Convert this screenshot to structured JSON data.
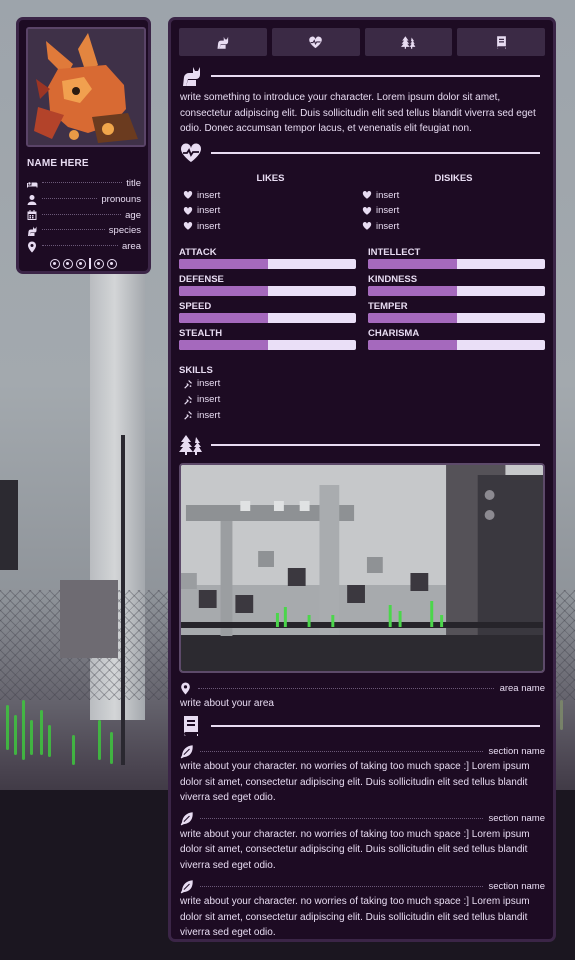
{
  "profile": {
    "name": "NAME HERE",
    "fields": [
      {
        "icon": "bed-icon",
        "value": "title"
      },
      {
        "icon": "person-icon",
        "value": "pronouns"
      },
      {
        "icon": "calendar-icon",
        "value": "age"
      },
      {
        "icon": "cat-icon",
        "value": "species"
      },
      {
        "icon": "map-pin-icon",
        "value": "area"
      }
    ]
  },
  "tabs": [
    {
      "icon": "cat-icon"
    },
    {
      "icon": "heart-pulse-icon"
    },
    {
      "icon": "trees-icon"
    },
    {
      "icon": "book-icon"
    }
  ],
  "intro": {
    "text": "write something to introduce your character. Lorem ipsum dolor sit amet, consectetur adipiscing elit. Duis sollicitudin elit sed tellus blandit viverra sed eget odio. Donec accumsan tempor lacus, et venenatis elit feugiat non."
  },
  "likes": {
    "title": "LIKES",
    "items": [
      "insert",
      "insert",
      "insert"
    ]
  },
  "dislikes": {
    "title": "DISIKES",
    "items": [
      "insert",
      "insert",
      "insert"
    ]
  },
  "stats": [
    {
      "label": "ATTACK",
      "value": 0.5
    },
    {
      "label": "INTELLECT",
      "value": 0.5
    },
    {
      "label": "DEFENSE",
      "value": 0.5
    },
    {
      "label": "KINDNESS",
      "value": 0.5
    },
    {
      "label": "SPEED",
      "value": 0.5
    },
    {
      "label": "TEMPER",
      "value": 0.5
    },
    {
      "label": "STEALTH",
      "value": 0.5
    },
    {
      "label": "CHARISMA",
      "value": 0.5
    }
  ],
  "skills": {
    "title": "SKILLS",
    "items": [
      "insert",
      "insert",
      "insert"
    ]
  },
  "area": {
    "name": "area name",
    "text": "write about your area"
  },
  "lore": [
    {
      "name": "section name",
      "text": "write about your character. no worries of taking too much space :] Lorem ipsum dolor sit amet, consectetur adipiscing elit. Duis sollicitudin elit sed tellus blandit viverra sed eget odio."
    },
    {
      "name": "section name",
      "text": "write about your character. no worries of taking too much space :] Lorem ipsum dolor sit amet, consectetur adipiscing elit. Duis sollicitudin elit sed tellus blandit viverra sed eget odio."
    },
    {
      "name": "section name",
      "text": "write about your character. no worries of taking too much space :] Lorem ipsum dolor sit amet, consectetur adipiscing elit. Duis sollicitudin elit sed tellus blandit viverra sed eget odio."
    }
  ],
  "colors": {
    "panel": "#1d0b23",
    "accent": "#a569bd",
    "bar_track": "#eadff7",
    "text": "#e8dcf2"
  }
}
